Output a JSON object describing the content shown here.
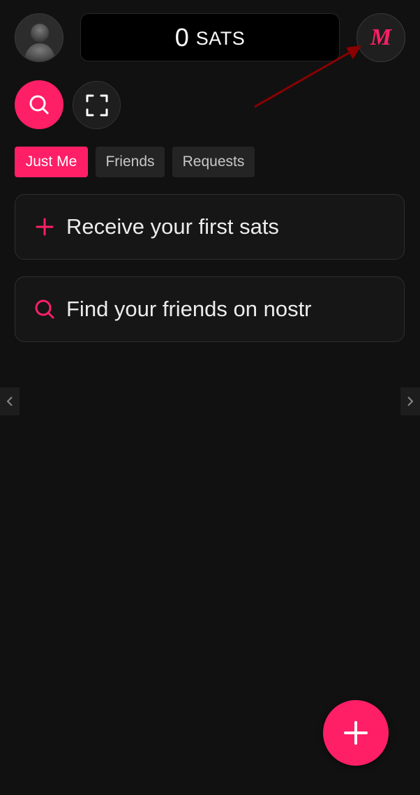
{
  "header": {
    "balance_amount": "0",
    "balance_unit": "SATS",
    "avatar_icon": "user-silhouette-icon",
    "mint_label": "M"
  },
  "actions": {
    "search_icon": "search-icon",
    "scan_icon": "scan-frame-icon"
  },
  "tabs": [
    {
      "label": "Just Me",
      "active": true
    },
    {
      "label": "Friends",
      "active": false
    },
    {
      "label": "Requests",
      "active": false
    }
  ],
  "cards": [
    {
      "icon": "plus-icon",
      "label": "Receive your first sats"
    },
    {
      "icon": "search-icon",
      "label": "Find your friends on nostr"
    }
  ],
  "fab": {
    "icon": "plus-icon"
  },
  "colors": {
    "accent": "#ff1f66",
    "background": "#111111",
    "card": "#161616",
    "annotation_arrow": "#8b0000"
  }
}
